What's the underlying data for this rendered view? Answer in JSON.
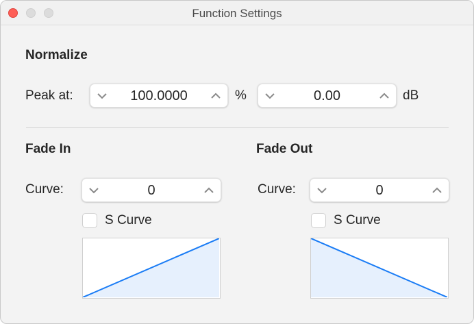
{
  "window": {
    "title": "Function Settings"
  },
  "normalize": {
    "heading": "Normalize",
    "peak_label": "Peak at:",
    "percent_value": "100.0000",
    "percent_unit": "%",
    "db_value": "0.00",
    "db_unit": "dB"
  },
  "fade_in": {
    "heading": "Fade In",
    "curve_label": "Curve:",
    "curve_value": "0",
    "s_curve_label": "S Curve",
    "s_curve_checked": false
  },
  "fade_out": {
    "heading": "Fade Out",
    "curve_label": "Curve:",
    "curve_value": "0",
    "s_curve_label": "S Curve",
    "s_curve_checked": false
  },
  "colors": {
    "close": "#fe5f57",
    "inactive": "#dcdcdc",
    "curve": "#1a7cf5",
    "fill": "#e6f0fd"
  }
}
